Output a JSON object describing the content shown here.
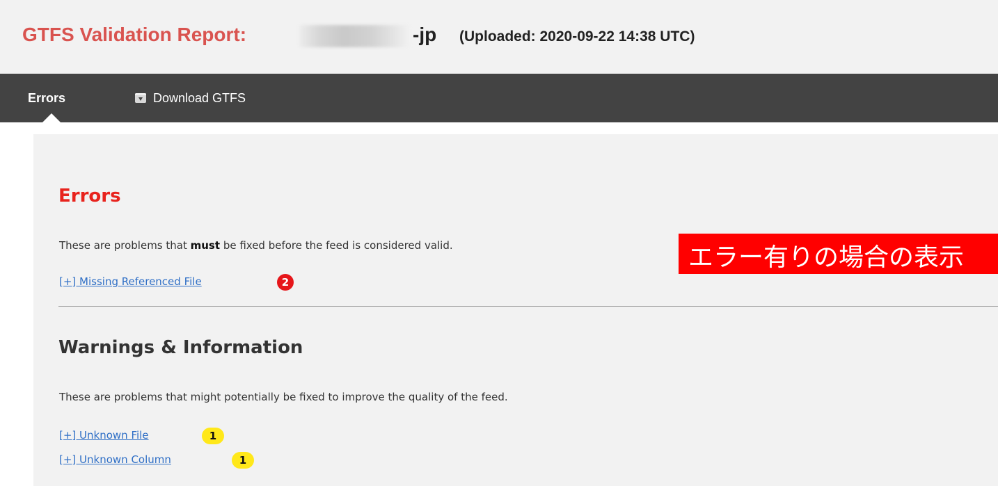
{
  "header": {
    "title_prefix": "GTFS Validation Report:",
    "feed_name_suffix": "-jp",
    "uploaded_text": "(Uploaded: 2020-09-22 14:38 UTC)"
  },
  "nav": {
    "errors_label": "Errors",
    "download_label": "Download GTFS",
    "download_icon": "download-box-icon",
    "active_tab": "Errors"
  },
  "errors_section": {
    "title": "Errors",
    "description_before": "These are problems that ",
    "description_bold": "must",
    "description_after": " be fixed before the feed is considered valid.",
    "items": [
      {
        "label": "[+] Missing Referenced File",
        "count": "2"
      }
    ]
  },
  "warnings_section": {
    "title": "Warnings & Information",
    "description": "These are problems that might potentially be fixed to improve the quality of the feed.",
    "items": [
      {
        "label": "[+] Unknown File ",
        "count": "1"
      },
      {
        "label": "[+] Unknown Column ",
        "count": "1"
      }
    ]
  },
  "annotation": {
    "text": "エラー有りの場合の表示"
  },
  "colors": {
    "title_red": "#d9534f",
    "errors_red": "#e8231d",
    "navbar": "#434343",
    "link_blue": "#2f6fc6",
    "badge_red": "#e6161a",
    "badge_yellow": "#ffe81a",
    "annotation_red": "#ff0000"
  }
}
